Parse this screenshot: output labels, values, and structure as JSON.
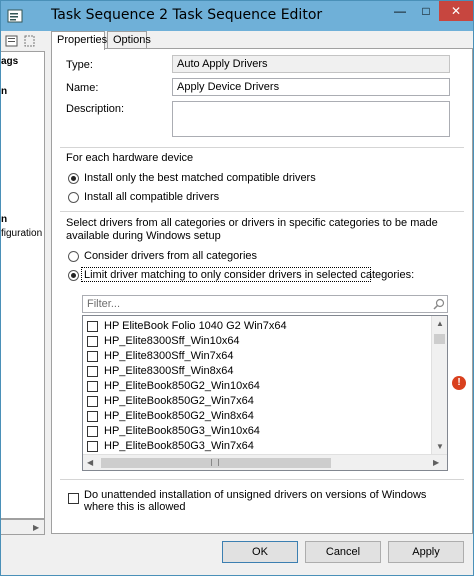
{
  "window": {
    "title": "Task Sequence 2 Task Sequence Editor",
    "minimize_glyph": "—",
    "maximize_glyph": "□",
    "close_glyph": "✕",
    "icon": "task-sequence-icon"
  },
  "left_pane": {
    "tree_items": [
      "ags",
      "n",
      "n",
      "figuration"
    ]
  },
  "tabs": {
    "properties": "Properties",
    "options": "Options"
  },
  "form": {
    "type_label": "Type:",
    "type_value": "Auto Apply Drivers",
    "name_label": "Name:",
    "name_value": "Apply Device Drivers",
    "description_label": "Description:",
    "description_value": ""
  },
  "hardware_section": {
    "heading": "For each hardware device",
    "option_best": "Install only the best matched compatible drivers",
    "option_all": "Install all compatible drivers",
    "selected": "best"
  },
  "category_section": {
    "heading": "Select drivers from all categories or drivers in specific categories to be made available during Windows setup",
    "option_all": "Consider drivers from all categories",
    "option_limit": "Limit driver matching to only consider drivers in selected categories:",
    "selected": "limit",
    "filter_placeholder": "Filter...",
    "categories": [
      "HP EliteBook Folio 1040 G2 Win7x64",
      "HP_Elite8300Sff_Win10x64",
      "HP_Elite8300Sff_Win7x64",
      "HP_Elite8300Sff_Win8x64",
      "HP_EliteBook850G2_Win10x64",
      "HP_EliteBook850G2_Win7x64",
      "HP_EliteBook850G2_Win8x64",
      "HP_EliteBook850G3_Win10x64",
      "HP_EliteBook850G3_Win7x64"
    ]
  },
  "unattended": {
    "label": "Do unattended installation of unsigned drivers on versions of Windows where this is allowed",
    "checked": false
  },
  "error_glyph": "!",
  "buttons": {
    "ok": "OK",
    "cancel": "Cancel",
    "apply": "Apply"
  },
  "colors": {
    "titlebar": "#6fb0d8",
    "close": "#c7463f",
    "error": "#d9401e"
  }
}
